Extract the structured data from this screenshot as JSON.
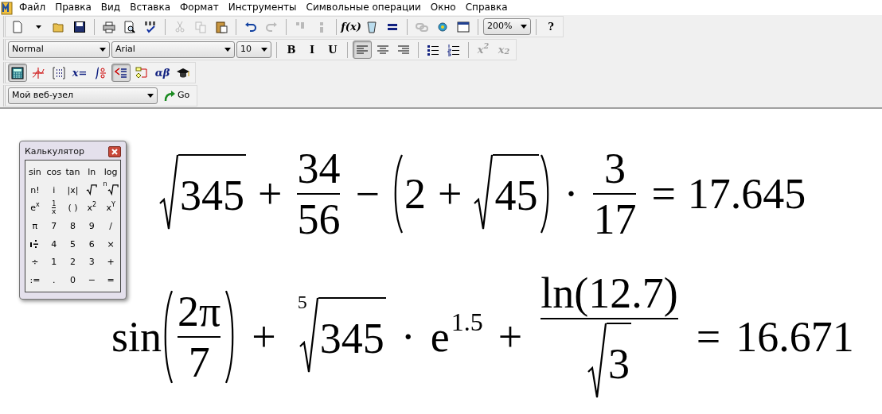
{
  "menu": [
    {
      "label": "Файл"
    },
    {
      "label": "Правка"
    },
    {
      "label": "Вид"
    },
    {
      "label": "Вставка"
    },
    {
      "label": "Формат"
    },
    {
      "label": "Инструменты"
    },
    {
      "label": "Символьные операции"
    },
    {
      "label": "Окно"
    },
    {
      "label": "Справка"
    }
  ],
  "toolbars": [
    {
      "items": [
        {
          "kind": "icon",
          "disabled": false
        },
        {
          "kind": "icon",
          "disabled": false
        },
        {
          "kind": "icon",
          "disabled": false
        },
        {
          "kind": "icon",
          "disabled": false
        },
        {
          "kind": "sep"
        },
        {
          "kind": "icon",
          "disabled": false
        },
        {
          "kind": "icon",
          "disabled": false
        },
        {
          "kind": "icon",
          "disabled": false
        },
        {
          "kind": "sep"
        },
        {
          "kind": "icon",
          "disabled": true
        },
        {
          "kind": "icon",
          "disabled": true
        },
        {
          "kind": "icon",
          "disabled": false
        },
        {
          "kind": "sep"
        },
        {
          "kind": "icon",
          "disabled": false
        },
        {
          "kind": "icon",
          "disabled": true
        },
        {
          "kind": "sep"
        },
        {
          "kind": "icon",
          "disabled": true
        },
        {
          "kind": "icon",
          "disabled": true
        },
        {
          "kind": "sep"
        },
        {
          "kind": "text",
          "label": "f(x)",
          "disabled": false
        },
        {
          "kind": "icon",
          "disabled": false
        },
        {
          "kind": "icon",
          "disabled": false
        },
        {
          "kind": "sep"
        },
        {
          "kind": "icon",
          "disabled": true
        },
        {
          "kind": "icon",
          "disabled": false
        },
        {
          "kind": "icon",
          "disabled": false
        },
        {
          "kind": "sep"
        },
        {
          "kind": "combo",
          "value": "200%"
        },
        {
          "kind": "sep"
        },
        {
          "kind": "text",
          "label": "?",
          "disabled": false
        }
      ]
    },
    {
      "items": [
        {
          "kind": "combo",
          "value": "Normal"
        },
        {
          "kind": "combo",
          "value": "Arial"
        },
        {
          "kind": "combo",
          "value": "10"
        },
        {
          "kind": "sep"
        },
        {
          "kind": "text",
          "label": "B",
          "disabled": false,
          "pressed": false
        },
        {
          "kind": "text",
          "label": "I",
          "disabled": false,
          "pressed": false
        },
        {
          "kind": "text",
          "label": "U",
          "disabled": false,
          "pressed": false
        },
        {
          "kind": "sep"
        },
        {
          "kind": "icon",
          "disabled": false,
          "pressed": true
        },
        {
          "kind": "icon",
          "disabled": false,
          "pressed": false
        },
        {
          "kind": "icon",
          "disabled": false,
          "pressed": false
        },
        {
          "kind": "sep"
        },
        {
          "kind": "icon",
          "disabled": false,
          "pressed": false
        },
        {
          "kind": "icon",
          "disabled": false,
          "pressed": false
        },
        {
          "kind": "sep"
        },
        {
          "kind": "text",
          "label": "x$^{2}$",
          "disabled": true,
          "pressed": false
        },
        {
          "kind": "text",
          "label": "x$_{2}$",
          "disabled": true,
          "pressed": false
        }
      ]
    },
    {
      "items": [
        {
          "kind": "icon",
          "disabled": false,
          "pressed": true
        },
        {
          "kind": "icon",
          "disabled": false,
          "pressed": false
        },
        {
          "kind": "icon",
          "disabled": false,
          "pressed": false
        },
        {
          "kind": "text",
          "label": "x=",
          "disabled": false,
          "pressed": false
        },
        {
          "kind": "icon",
          "disabled": false,
          "pressed": false
        },
        {
          "kind": "icon",
          "disabled": false,
          "pressed": true
        },
        {
          "kind": "icon",
          "disabled": false,
          "pressed": false
        },
        {
          "kind": "text",
          "label": "αβ",
          "disabled": false,
          "pressed": false
        },
        {
          "kind": "icon",
          "disabled": false,
          "pressed": false
        }
      ]
    },
    {
      "items": [
        {
          "kind": "combo",
          "value": "Мой веб-узел"
        },
        {
          "kind": "go",
          "label": "Go"
        }
      ]
    }
  ],
  "calculator": {
    "title": "Калькулятор",
    "keys": [
      {
        "kind": "text",
        "label": "sin"
      },
      {
        "kind": "text",
        "label": "cos"
      },
      {
        "kind": "text",
        "label": "tan"
      },
      {
        "kind": "text",
        "label": "ln"
      },
      {
        "kind": "text",
        "label": "log"
      },
      {
        "kind": "text",
        "label": "n!"
      },
      {
        "kind": "text",
        "label": "i"
      },
      {
        "kind": "text",
        "label": "|x|"
      },
      {
        "kind": "root"
      },
      {
        "kind": "root",
        "index": "n"
      },
      {
        "kind": "text",
        "label": "e$^{x}$"
      },
      {
        "kind": "fraction",
        "num": "1",
        "den": "x"
      },
      {
        "kind": "text",
        "label": "( )"
      },
      {
        "kind": "text",
        "label": "x$^{2}$"
      },
      {
        "kind": "text",
        "label": "x$^{Y}$"
      },
      {
        "kind": "text",
        "label": "π"
      },
      {
        "kind": "text",
        "label": "7"
      },
      {
        "kind": "text",
        "label": "8"
      },
      {
        "kind": "text",
        "label": "9"
      },
      {
        "kind": "text",
        "label": "/"
      },
      {
        "kind": "range"
      },
      {
        "kind": "text",
        "label": "4"
      },
      {
        "kind": "text",
        "label": "5"
      },
      {
        "kind": "text",
        "label": "6"
      },
      {
        "kind": "text",
        "label": "×"
      },
      {
        "kind": "text",
        "label": "÷"
      },
      {
        "kind": "text",
        "label": "1"
      },
      {
        "kind": "text",
        "label": "2"
      },
      {
        "kind": "text",
        "label": "3"
      },
      {
        "kind": "text",
        "label": "+"
      },
      {
        "kind": "text",
        "label": ":="
      },
      {
        "kind": "text",
        "label": "."
      },
      {
        "kind": "text",
        "label": "0"
      },
      {
        "kind": "text",
        "label": "−"
      },
      {
        "kind": "text",
        "label": "="
      }
    ]
  },
  "equations": [
    {
      "terms": [
        {
          "kind": "sqrt",
          "body": [
            {
              "kind": "text",
              "text": "345"
            }
          ]
        },
        {
          "kind": "op",
          "text": "+"
        },
        {
          "kind": "frac",
          "num": [
            {
              "kind": "text",
              "text": "34"
            }
          ],
          "den": [
            {
              "kind": "text",
              "text": "56"
            }
          ]
        },
        {
          "kind": "op",
          "text": "−"
        },
        {
          "kind": "paren",
          "body": [
            {
              "kind": "text",
              "text": "2"
            },
            {
              "kind": "op",
              "text": "+"
            },
            {
              "kind": "sqrt",
              "body": [
                {
                  "kind": "text",
                  "text": "45"
                }
              ]
            }
          ]
        },
        {
          "kind": "op",
          "text": "·"
        },
        {
          "kind": "frac",
          "num": [
            {
              "kind": "text",
              "text": "3"
            }
          ],
          "den": [
            {
              "kind": "text",
              "text": "17"
            }
          ]
        },
        {
          "kind": "op",
          "text": "="
        },
        {
          "kind": "text",
          "text": "17.645"
        }
      ]
    },
    {
      "terms": [
        {
          "kind": "text",
          "text": "sin"
        },
        {
          "kind": "paren",
          "body": [
            {
              "kind": "frac",
              "num": [
                {
                  "kind": "text",
                  "text": "2π"
                }
              ],
              "den": [
                {
                  "kind": "text",
                  "text": "7"
                }
              ]
            }
          ]
        },
        {
          "kind": "op",
          "text": "+"
        },
        {
          "kind": "sqrt",
          "index": "5",
          "body": [
            {
              "kind": "text",
              "text": "345"
            }
          ]
        },
        {
          "kind": "op",
          "text": "·"
        },
        {
          "kind": "sup",
          "base": "e",
          "exp": "1.5"
        },
        {
          "kind": "op",
          "text": "+"
        },
        {
          "kind": "frac",
          "num": [
            {
              "kind": "text",
              "text": "ln(12.7)"
            }
          ],
          "den": [
            {
              "kind": "sqrt",
              "body": [
                {
                  "kind": "text",
                  "text": "3"
                }
              ]
            }
          ]
        },
        {
          "kind": "op",
          "text": "="
        },
        {
          "kind": "text",
          "text": "16.671"
        }
      ]
    }
  ]
}
